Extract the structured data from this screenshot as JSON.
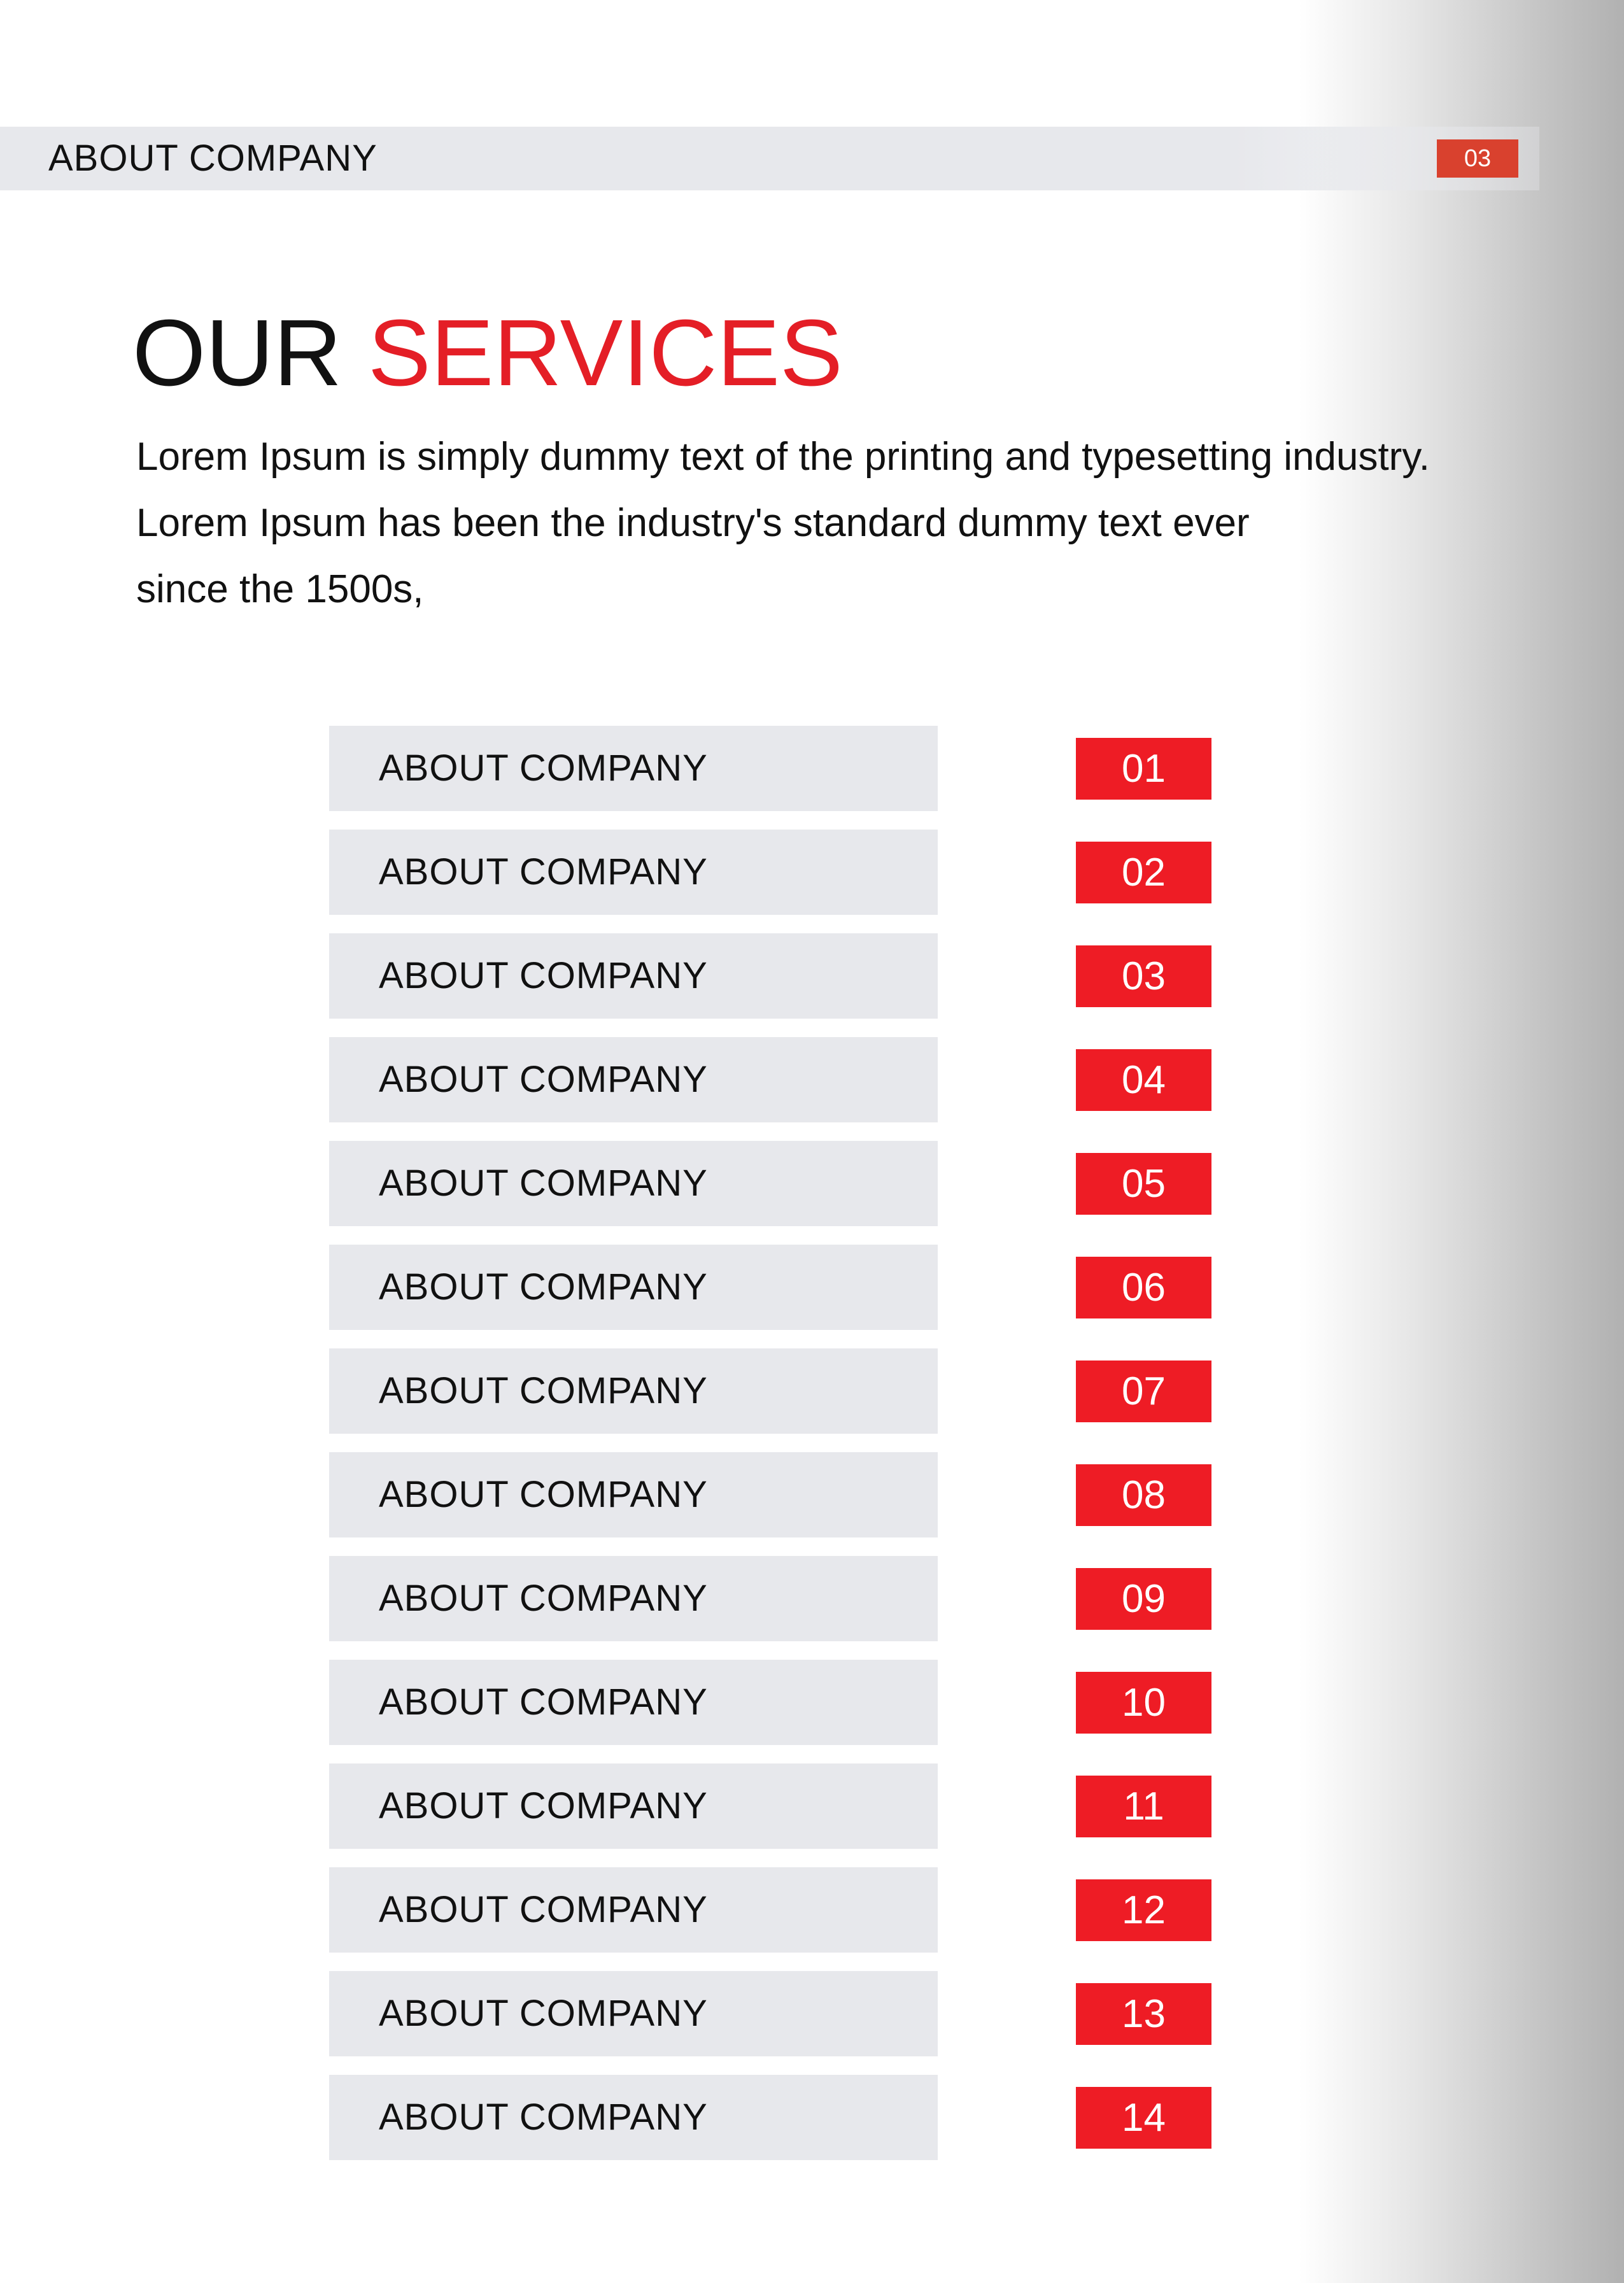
{
  "header": {
    "title": "ABOUT COMPANY",
    "page_number": "03"
  },
  "heading": {
    "part1": "OUR",
    "part2": "SERVICES"
  },
  "intro": {
    "lines": [
      "Lorem Ipsum is simply dummy text of the printing and typesetting industry.",
      "Lorem Ipsum has been the industry's standard dummy text ever",
      "since the 1500s,"
    ]
  },
  "services": [
    {
      "label": "ABOUT COMPANY",
      "number": "01"
    },
    {
      "label": "ABOUT COMPANY",
      "number": "02"
    },
    {
      "label": "ABOUT COMPANY",
      "number": "03"
    },
    {
      "label": "ABOUT COMPANY",
      "number": "04"
    },
    {
      "label": "ABOUT COMPANY",
      "number": "05"
    },
    {
      "label": "ABOUT COMPANY",
      "number": "06"
    },
    {
      "label": "ABOUT COMPANY",
      "number": "07"
    },
    {
      "label": "ABOUT COMPANY",
      "number": "08"
    },
    {
      "label": "ABOUT COMPANY",
      "number": "09"
    },
    {
      "label": "ABOUT COMPANY",
      "number": "10"
    },
    {
      "label": "ABOUT COMPANY",
      "number": "11"
    },
    {
      "label": "ABOUT COMPANY",
      "number": "12"
    },
    {
      "label": "ABOUT COMPANY",
      "number": "13"
    },
    {
      "label": "ABOUT COMPANY",
      "number": "14"
    }
  ],
  "colors": {
    "accent": "#ee1c25",
    "header_badge": "#d9412e",
    "row_background": "#e7e8ec",
    "text": "#111111"
  }
}
